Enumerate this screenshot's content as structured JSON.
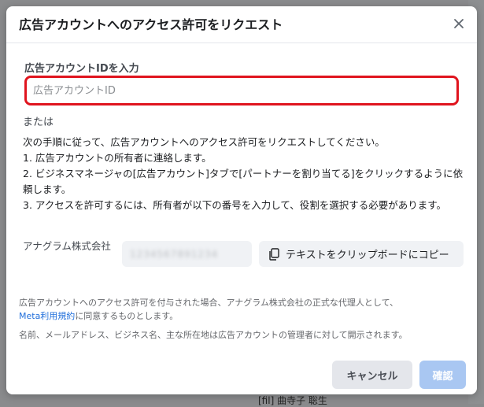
{
  "background": {
    "fragments": [
      "…",
      "…",
      "…"
    ],
    "bottom_text": "[fil]  曲寺子 聡生"
  },
  "dialog": {
    "title": "広告アカウントへのアクセス許可をリクエスト",
    "close_icon": "close-icon",
    "id_label": "広告アカウントIDを入力",
    "id_input": {
      "value": "",
      "placeholder": "広告アカウントID"
    },
    "or_text": "または",
    "instructions": [
      "次の手順に従って、広告アカウントへのアクセス許可をリクエストしてください。",
      "1. 広告アカウントの所有者に連絡します。",
      "2. ビジネスマネージャの[広告アカウント]タブで[パートナーを割り当てる]をクリックするように依頼します。",
      "3. アクセスを許可するには、所有者が以下の番号を入力して、役割を選択する必要があります。"
    ],
    "company_name": "アナグラム株式会社",
    "partner_code": "1234567891234",
    "copy_button_label": "テキストをクリップボードにコピー",
    "copy_icon": "copy-icon",
    "legal_prefix": "広告アカウントへのアクセス許可を付与された場合、アナグラム株式会社の正式な代理人として、",
    "legal_link": "Meta利用規約",
    "legal_suffix": "に同意するものとします。",
    "disclosure": "名前、メールアドレス、ビジネス名、主な所在地は広告アカウントの管理者に対して開示されます。",
    "cancel_label": "キャンセル",
    "confirm_label": "確認"
  },
  "colors": {
    "accent": "#216fdb",
    "error_border": "#e0141e",
    "disabled_button": "#a9c7f2"
  }
}
